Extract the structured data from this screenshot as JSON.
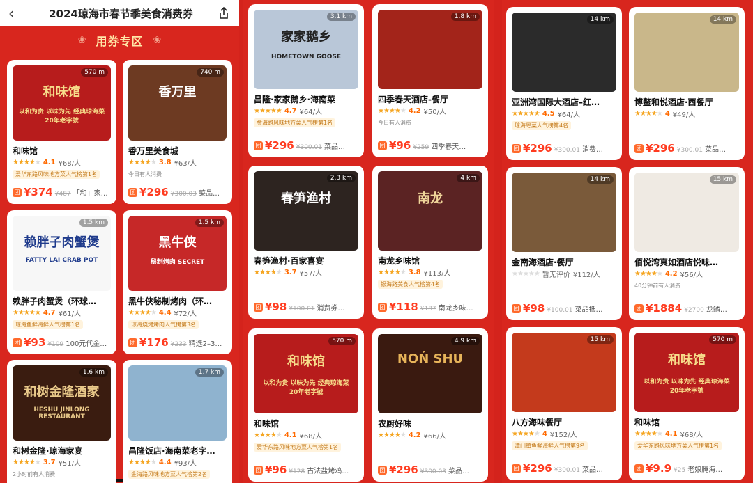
{
  "header": {
    "title": "2024琼海市春节季美食消费券",
    "back_icon": "chevron-left",
    "share_icon": "share"
  },
  "section": {
    "label": "用券专区"
  },
  "colors": {
    "background": "#d8261e",
    "accent_price": "#ff3b1f",
    "star": "#f5a623",
    "tag_text": "#c47a1a"
  },
  "panels": [
    [
      {
        "name": "和味馆",
        "distance": "570 m",
        "rating": 4.1,
        "stars": 4,
        "score": "4.1",
        "avg": "¥68/人",
        "tag": "爱华东路风味地方菜人气榜第1名",
        "tag_style": "rank",
        "price": "¥374",
        "orig": "¥487",
        "deal": "「和」家…",
        "img_title": "和味馆",
        "img_sub": "以和为贵 以味为先 经典琼海菜 20年老字號",
        "bg": "#b71c1c",
        "fg": "#f7dc8a"
      },
      {
        "name": "香万里美食城",
        "distance": "740 m",
        "rating": 3.8,
        "stars": 4,
        "score": "3.8",
        "avg": "¥63/人",
        "tag": "今日有人消费",
        "tag_style": "gray",
        "price": "¥296",
        "orig": "¥300.03",
        "deal": "菜品…",
        "img_title": "香万里",
        "img_sub": "",
        "bg": "#6d3a22",
        "fg": "#fff"
      },
      {
        "name": "赖胖子肉蟹煲（环球…",
        "distance": "1.5 km",
        "rating": 4.7,
        "stars": 5,
        "score": "4.7",
        "avg": "¥61/人",
        "tag": "琼海鱼鲜海鲜人气榜第1名",
        "tag_style": "rank",
        "price": "¥93",
        "orig": "¥109",
        "deal": "100元代金…",
        "img_title": "赖胖子肉蟹煲",
        "img_sub": "FATTY LAI CRAB POT",
        "bg": "#f7f7f7",
        "fg": "#1f3b8c"
      },
      {
        "name": "黑牛侠秘制烤肉（环…",
        "distance": "1.5 km",
        "rating": 4.4,
        "stars": 4,
        "score": "4.4",
        "avg": "¥72/人",
        "tag": "琼海烧烤烤肉人气榜第3名",
        "tag_style": "rank",
        "price": "¥176",
        "orig": "¥233",
        "deal": "精选2–3…",
        "img_title": "黑牛侠",
        "img_sub": "秘制烤肉 SECRET",
        "bg": "#c62828",
        "fg": "#fff"
      },
      {
        "name": "和树金隆·琼海家宴",
        "distance": "1.6 km",
        "rating": 3.7,
        "stars": 4,
        "score": "3.7",
        "avg": "¥51/人",
        "tag": "2小时前有人消费",
        "tag_style": "gray",
        "price": "",
        "orig": "",
        "deal": "",
        "img_title": "和树金隆酒家",
        "img_sub": "HESHU JINLONG RESTAURANT",
        "bg": "#3a1c10",
        "fg": "#e9c98a"
      },
      {
        "name": "昌隆饭店·海南菜老字…",
        "distance": "1.7 km",
        "rating": 4.4,
        "stars": 4,
        "score": "4.4",
        "avg": "¥93/人",
        "tag": "金海路风味地方菜人气榜第2名",
        "tag_style": "rank",
        "price": "",
        "orig": "",
        "deal": "",
        "img_title": "",
        "img_sub": "",
        "bg": "#8fb3cf",
        "fg": "#fff"
      }
    ],
    [
      {
        "name": "昌隆·家家鹅乡·海南菜",
        "distance": "3.1 km",
        "rating": 4.7,
        "stars": 5,
        "score": "4.7",
        "avg": "¥64/人",
        "tag": "金海路风味地方菜人气榜第1名",
        "tag_style": "rank",
        "price": "¥296",
        "orig": "¥300.01",
        "deal": "菜品…",
        "img_title": "家家鹅乡",
        "img_sub": "HOMETOWN GOOSE",
        "bg": "#b9c7d8",
        "fg": "#222"
      },
      {
        "name": "四季春天酒店-餐厅",
        "distance": "1.8 km",
        "rating": 4.2,
        "stars": 4,
        "score": "4.2",
        "avg": "¥50/人",
        "tag": "今日有人消费",
        "tag_style": "gray",
        "price": "¥96",
        "orig": "¥259",
        "deal": "四季春天…",
        "img_title": "",
        "img_sub": "",
        "bg": "#a3241a",
        "fg": "#fff"
      },
      {
        "name": "春笋渔村·百家喜宴",
        "distance": "2.3 km",
        "rating": 3.7,
        "stars": 4,
        "score": "3.7",
        "avg": "¥57/人",
        "tag": "",
        "tag_style": "gray",
        "price": "¥98",
        "orig": "¥100.01",
        "deal": "消费券…",
        "img_title": "春笋渔村",
        "img_sub": "",
        "bg": "#2d2420",
        "fg": "#fff"
      },
      {
        "name": "南龙乡味馆",
        "distance": "4 km",
        "rating": 3.8,
        "stars": 4,
        "score": "3.8",
        "avg": "¥113/人",
        "tag": "银海路美食人气榜第4名",
        "tag_style": "rank",
        "price": "¥118",
        "orig": "¥187",
        "deal": "南龙乡味…",
        "img_title": "南龙",
        "img_sub": "",
        "bg": "#5b2323",
        "fg": "#f0d59a"
      },
      {
        "name": "和味馆",
        "distance": "570 m",
        "rating": 4.1,
        "stars": 4,
        "score": "4.1",
        "avg": "¥68/人",
        "tag": "爱华东路风味地方菜人气榜第1名",
        "tag_style": "rank",
        "price": "¥96",
        "orig": "¥128",
        "deal": "古法盐烤鸡…",
        "img_title": "和味馆",
        "img_sub": "以和为贵 以味为先 经典琼海菜 20年老字號",
        "bg": "#b71c1c",
        "fg": "#f7dc8a"
      },
      {
        "name": "农厨好味",
        "distance": "4.9 km",
        "rating": 4.2,
        "stars": 4,
        "score": "4.2",
        "avg": "¥66/人",
        "tag": "",
        "tag_style": "gray",
        "price": "¥296",
        "orig": "¥300.03",
        "deal": "菜品…",
        "img_title": "NOŃ SHU",
        "img_sub": "",
        "bg": "#3a1a10",
        "fg": "#e7b45a"
      }
    ],
    [
      {
        "name": "亚洲湾国际大酒店–红…",
        "distance": "14 km",
        "rating": 4.5,
        "stars": 5,
        "score": "4.5",
        "avg": "¥64/人",
        "tag": "琼海粤菜人气榜第4名",
        "tag_style": "rank",
        "price": "¥296",
        "orig": "¥300.01",
        "deal": "消费…",
        "img_title": "",
        "img_sub": "",
        "bg": "#2b2b2b",
        "fg": "#fff"
      },
      {
        "name": "博鳌和悦酒店·西餐厅",
        "distance": "14 km",
        "rating": 4,
        "stars": 4,
        "score": "4",
        "avg": "¥49/人",
        "tag": "",
        "tag_style": "gray",
        "price": "¥296",
        "orig": "¥300.01",
        "deal": "菜品…",
        "img_title": "",
        "img_sub": "",
        "bg": "#c9b78a",
        "fg": "#fff"
      },
      {
        "name": "金南海酒店·餐厅",
        "distance": "14 km",
        "rating": 0,
        "stars": 0,
        "score": "",
        "avg": "暂无评价",
        "avg2": "¥112/人",
        "tag": "",
        "tag_style": "gray",
        "price": "¥98",
        "orig": "¥100.01",
        "deal": "菜品抵…",
        "img_title": "",
        "img_sub": "",
        "bg": "#7a5a3a",
        "fg": "#fff"
      },
      {
        "name": "佰悦湾真如酒店悦味…",
        "distance": "15 km",
        "rating": 4.2,
        "stars": 4,
        "score": "4.2",
        "avg": "¥56/人",
        "tag": "40分钟前有人消费",
        "tag_style": "gray",
        "price": "¥1884",
        "orig": "¥2700",
        "deal": "龙鳞…",
        "img_title": "",
        "img_sub": "",
        "bg": "#efeae3",
        "fg": "#333"
      },
      {
        "name": "八方海味餐厅",
        "distance": "15 km",
        "rating": 4,
        "stars": 4,
        "score": "4",
        "avg": "¥152/人",
        "tag": "潭门镇鱼鲜海鲜人气榜第9名",
        "tag_style": "rank",
        "price": "¥296",
        "orig": "¥300.01",
        "deal": "菜品…",
        "img_title": "",
        "img_sub": "",
        "bg": "#c43a1c",
        "fg": "#fff"
      },
      {
        "name": "和味馆",
        "distance": "570 m",
        "rating": 4.1,
        "stars": 4,
        "score": "4.1",
        "avg": "¥68/人",
        "tag": "爱华东路风味地方菜人气榜第1名",
        "tag_style": "rank",
        "price": "¥9.9",
        "orig": "¥25",
        "deal": "老娘腌海…",
        "img_title": "和味馆",
        "img_sub": "以和为贵 以味为先 经典琼海菜 20年老字號",
        "bg": "#b71c1c",
        "fg": "#f7dc8a"
      }
    ]
  ]
}
